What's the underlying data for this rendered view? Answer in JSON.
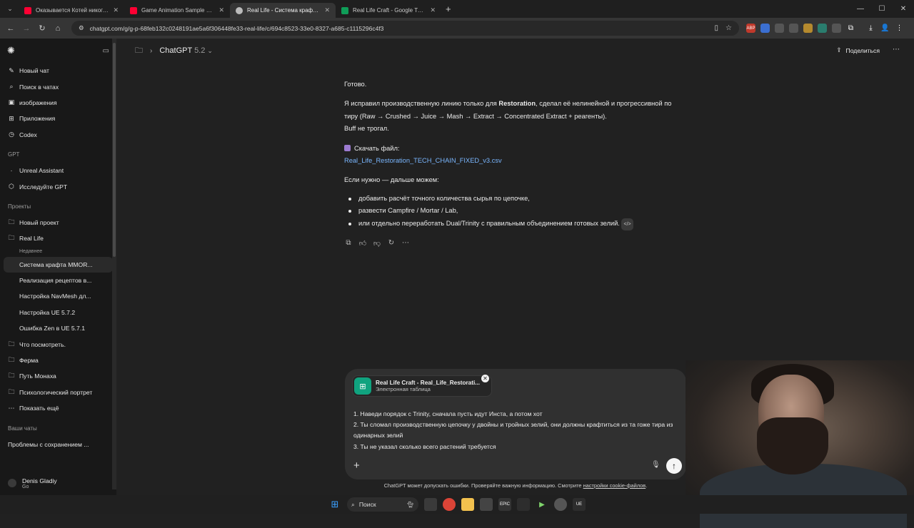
{
  "browser": {
    "tabs": [
      {
        "title": "Оказывается Котей никогда не",
        "color": "#ff0033"
      },
      {
        "title": "Game Animation Sample Proje",
        "color": "#ff0033"
      },
      {
        "title": "Real Life - Система крафта MM",
        "color": "#bbbbbb"
      },
      {
        "title": "Real Life Craft - Google Табли",
        "color": "#0f9d58"
      }
    ],
    "url": "chatgpt.com/g/g-p-68feb132c0248191ae5a6f306448fe33-real-life/c/694c8523-33e0-8327-a685-c1115296c4f3",
    "extensions": [
      "ABP"
    ]
  },
  "sidebar": {
    "top_items": [
      {
        "label": "Новый чат",
        "icon": "✎"
      },
      {
        "label": "Поиск в чатах",
        "icon": "⌕"
      },
      {
        "label": "изображения",
        "icon": "▣"
      },
      {
        "label": "Приложения",
        "icon": "⊞"
      },
      {
        "label": "Codex",
        "icon": "◷"
      }
    ],
    "gpt_label": "GPT",
    "gpts": [
      {
        "label": "Unreal Assistant",
        "icon": "·"
      },
      {
        "label": "Исследуйте GPT",
        "icon": "⬡"
      }
    ],
    "projects_label": "Проекты",
    "projects": [
      {
        "label": "Новый проект",
        "icon": "🗀"
      },
      {
        "label": "Real Life",
        "icon": "🗀"
      }
    ],
    "recent_label": "Недавнее",
    "recent": [
      "Система крафта MMOR...",
      "Реализация рецептов в...",
      "Настройка NavMesh дл...",
      "Настройка UE 5.7.2",
      "Ошибка Zen в UE 5.7.1"
    ],
    "more_projects": [
      {
        "label": "Что посмотреть.",
        "icon": "🗀"
      },
      {
        "label": "Ферма",
        "icon": "🗀"
      },
      {
        "label": "Путь Монаха",
        "icon": "🗀"
      },
      {
        "label": "Психологический портрет",
        "icon": "🗀"
      },
      {
        "label": "Показать ещё",
        "icon": "⋯"
      }
    ],
    "chats_label": "Ваши чаты",
    "chats": [
      "Проблемы с сохранением ..."
    ],
    "user": {
      "name": "Denis Gladiy",
      "plan": "Go"
    }
  },
  "header": {
    "title": "ChatGPT",
    "version": "5.2",
    "share": "Поделиться"
  },
  "message": {
    "line1": "Готово.",
    "p2_a": "Я исправил производственную линию только для ",
    "p2_b": "Restoration",
    "p2_c": ", сделал её нелинейной и прогрессивной по тиру (Raw → Crushed → Juice → Mash → Extract → Concentrated Extract + реагенты).",
    "p3": "Buff не трогал.",
    "download_label": "Скачать файл:",
    "file_link": "Real_Life_Restoration_TECH_CHAIN_FIXED_v3.csv",
    "next_label": "Если нужно — дальше можем:",
    "bullets": [
      "добавить расчёт точного количества сырья по цепочке,",
      "развести Campfire / Mortar / Lab,",
      "или отдельно переработать Dual/Trinity с правильным объединением готовых зелий."
    ]
  },
  "composer": {
    "attachment_title": "Real Life Craft - Real_Life_Restorati...",
    "attachment_subtitle": "Электронная таблица",
    "lines": [
      "1. Наведи порядок с Trinity, сначала пусть идут Инста, а потом хот",
      "2. Ты сломал производственную цепочку у двойны и тройных зелий, они должны крафтиться из та гоже тира из одинарных зелий",
      "3. Ты не указал сколько всего растений требуется"
    ]
  },
  "footer": {
    "text": "ChatGPT может допускать ошибки. Проверяйте важную информацию. Смотрите ",
    "link": "настройки cookie-файлов",
    "end": "."
  },
  "taskbar": {
    "search": "Поиск"
  }
}
